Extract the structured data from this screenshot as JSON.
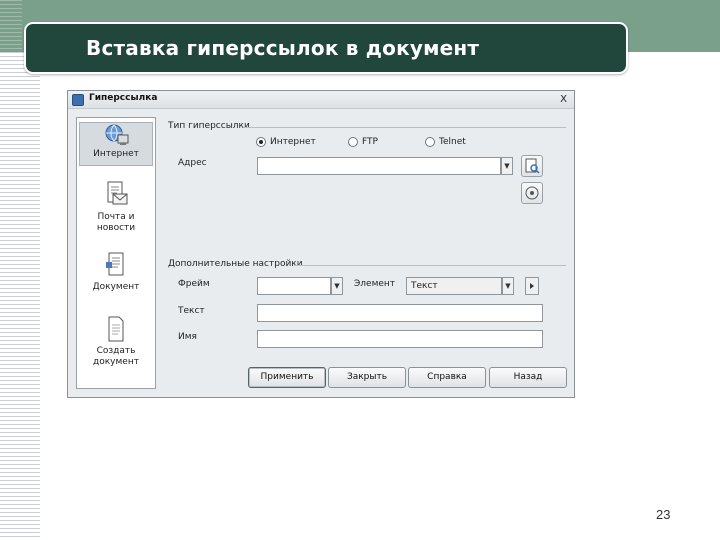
{
  "slide": {
    "title": "Вставка гиперссылок в документ",
    "page_number": "23"
  },
  "dialog": {
    "title": "Гиперссылка",
    "close_glyph": "X",
    "sidebar": [
      {
        "label": "Интернет",
        "icon": "globe-icon",
        "active": true
      },
      {
        "label": "Почта и\nновости",
        "icon": "mail-icon",
        "active": false
      },
      {
        "label": "Документ",
        "icon": "document-icon",
        "active": false
      },
      {
        "label": "Создать\nдокумент",
        "icon": "new-document-icon",
        "active": false
      }
    ],
    "link_type": {
      "group_label": "Тип гиперссылки",
      "options": [
        {
          "label": "Интернет",
          "selected": true
        },
        {
          "label": "FTP",
          "selected": false
        },
        {
          "label": "Telnet",
          "selected": false
        }
      ]
    },
    "address_label": "Адрес",
    "address_value": "",
    "extra": {
      "group_label": "Дополнительные настройки",
      "frame_label": "Фрейм",
      "frame_value": "",
      "element_label": "Элемент",
      "element_value": "Текст",
      "text_label": "Текст",
      "text_value": "",
      "name_label": "Имя",
      "name_value": ""
    },
    "buttons": {
      "apply": "Применить",
      "close": "Закрыть",
      "help": "Справка",
      "back": "Назад"
    }
  },
  "colors": {
    "title_bar": "#21463b",
    "top_band": "#7aa08c"
  }
}
